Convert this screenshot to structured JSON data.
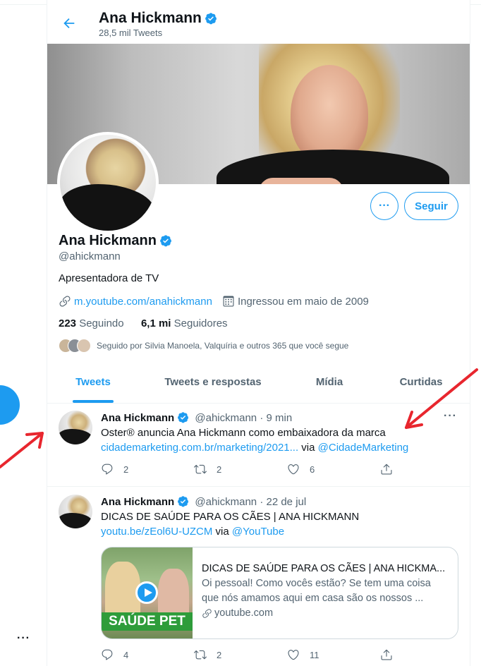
{
  "header": {
    "name": "Ana Hickmann",
    "tweet_count": "28,5 mil Tweets"
  },
  "profile": {
    "name": "Ana Hickmann",
    "handle": "@ahickmann",
    "bio": "Apresentadora de TV",
    "link": "m.youtube.com/anahickmann",
    "joined": "Ingressou em maio de 2009",
    "following_count": "223",
    "following_label": "Seguindo",
    "followers_count": "6,1 mi",
    "followers_label": "Seguidores",
    "followed_by": "Seguido por Silvia Manoela, Valquíria e outros 365 que você segue",
    "follow_button": "Seguir",
    "more_button": "···"
  },
  "tabs": [
    "Tweets",
    "Tweets e respostas",
    "Mídia",
    "Curtidas"
  ],
  "tweets": [
    {
      "name": "Ana Hickmann",
      "handle": "@ahickmann",
      "time": "· 9 min",
      "text": "Oster® anuncia Ana Hickmann como embaixadora da marca",
      "link": "cidademarketing.com.br/marketing/2021...",
      "via": " via ",
      "mention": "@CidadeMarketing",
      "replies": "2",
      "retweets": "2",
      "likes": "6"
    },
    {
      "name": "Ana Hickmann",
      "handle": "@ahickmann",
      "time": "· 22 de jul",
      "text": "DICAS DE SAÚDE PARA OS CÃES | ANA HICKMANN ",
      "link": "youtu.be/zEol6U-UZCM",
      "via": " via ",
      "mention": "@YouTube",
      "card": {
        "title": "DICAS DE SAÚDE PARA OS CÃES | ANA HICKMA...",
        "description": "Oi pessoal! Como vocês estão? Se tem uma coisa que nós amamos aqui em casa são os nossos ...",
        "domain": "youtube.com",
        "thumb_label": "SAÚDE PET"
      },
      "replies": "4",
      "retweets": "2",
      "likes": "11"
    }
  ],
  "colors": {
    "accent": "#1d9bf0",
    "text": "#0f1419",
    "muted": "#536471",
    "annotation_arrow": "#e8262e"
  },
  "left_rail": {
    "more": "···"
  }
}
